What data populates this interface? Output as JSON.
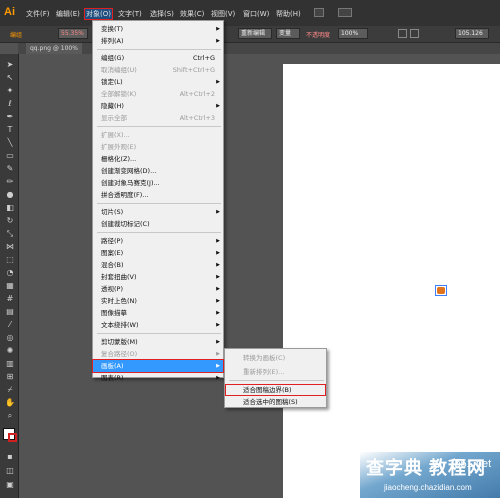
{
  "app": {
    "logo": "Ai"
  },
  "menubar": {
    "items": [
      "文件(F)",
      "编辑(E)",
      "对象(O)",
      "文字(T)",
      "选择(S)",
      "效果(C)",
      "视图(V)",
      "窗口(W)",
      "帮助(H)"
    ]
  },
  "controlbar": {
    "left_label": "编组",
    "opacity_left": "55.35%",
    "stroke_dropdown": "基本",
    "style_label": "重新编辑",
    "preset_label": "变量",
    "opacity_label": "不透明度",
    "opacity_value": "100%",
    "width_value": "105.126"
  },
  "document_tab": {
    "label": "qq.png @ 100%"
  },
  "object_menu": {
    "items": [
      {
        "label": "变换(T)",
        "shortcut": "",
        "submenu": true,
        "disabled": false
      },
      {
        "label": "排列(A)",
        "shortcut": "",
        "submenu": true,
        "disabled": false
      },
      {
        "sep": true
      },
      {
        "label": "编组(G)",
        "shortcut": "Ctrl+G",
        "submenu": false,
        "disabled": false
      },
      {
        "label": "取消编组(U)",
        "shortcut": "Shift+Ctrl+G",
        "submenu": false,
        "disabled": true
      },
      {
        "label": "锁定(L)",
        "shortcut": "",
        "submenu": true,
        "disabled": false
      },
      {
        "label": "全部解锁(K)",
        "shortcut": "Alt+Ctrl+2",
        "submenu": false,
        "disabled": true
      },
      {
        "label": "隐藏(H)",
        "shortcut": "",
        "submenu": true,
        "disabled": false
      },
      {
        "label": "显示全部",
        "shortcut": "Alt+Ctrl+3",
        "submenu": false,
        "disabled": true
      },
      {
        "sep": true
      },
      {
        "label": "扩展(X)...",
        "shortcut": "",
        "submenu": false,
        "disabled": true
      },
      {
        "label": "扩展外观(E)",
        "shortcut": "",
        "submenu": false,
        "disabled": true
      },
      {
        "label": "栅格化(Z)...",
        "shortcut": "",
        "submenu": false,
        "disabled": false
      },
      {
        "label": "创建渐变网格(D)...",
        "shortcut": "",
        "submenu": false,
        "disabled": false
      },
      {
        "label": "创建对象马赛克(J)...",
        "shortcut": "",
        "submenu": false,
        "disabled": false
      },
      {
        "label": "拼合透明度(F)...",
        "shortcut": "",
        "submenu": false,
        "disabled": false
      },
      {
        "sep": true
      },
      {
        "label": "切片(S)",
        "shortcut": "",
        "submenu": true,
        "disabled": false
      },
      {
        "label": "创建裁切标记(C)",
        "shortcut": "",
        "submenu": false,
        "disabled": false
      },
      {
        "sep": true
      },
      {
        "label": "路径(P)",
        "shortcut": "",
        "submenu": true,
        "disabled": false
      },
      {
        "label": "图案(E)",
        "shortcut": "",
        "submenu": true,
        "disabled": false
      },
      {
        "label": "混合(B)",
        "shortcut": "",
        "submenu": true,
        "disabled": false
      },
      {
        "label": "封套扭曲(V)",
        "shortcut": "",
        "submenu": true,
        "disabled": false
      },
      {
        "label": "透视(P)",
        "shortcut": "",
        "submenu": true,
        "disabled": false
      },
      {
        "label": "实时上色(N)",
        "shortcut": "",
        "submenu": true,
        "disabled": false
      },
      {
        "label": "图像描摹",
        "shortcut": "",
        "submenu": true,
        "disabled": false
      },
      {
        "label": "文本绕排(W)",
        "shortcut": "",
        "submenu": true,
        "disabled": false
      },
      {
        "sep": true
      },
      {
        "label": "剪切蒙版(M)",
        "shortcut": "",
        "submenu": true,
        "disabled": false
      },
      {
        "label": "复合路径(O)",
        "shortcut": "",
        "submenu": true,
        "disabled": true
      },
      {
        "label": "画板(A)",
        "shortcut": "",
        "submenu": true,
        "disabled": false,
        "highlighted": true
      },
      {
        "label": "图表(R)",
        "shortcut": "",
        "submenu": true,
        "disabled": false
      }
    ]
  },
  "artboard_submenu": {
    "items": [
      {
        "label": "转换为画板(C)",
        "disabled": true
      },
      {
        "label": "重新排列(E)...",
        "disabled": true
      },
      {
        "label": "适合图稿边界(B)",
        "disabled": false,
        "boxed": true
      },
      {
        "label": "适合选中的图稿(S)",
        "disabled": false
      }
    ]
  },
  "watermark": {
    "main": "查字典 教程网",
    "site": "jb51.net",
    "url": "jiaocheng.chazidian.com"
  },
  "colors": {
    "menu_highlight": "#3399ff",
    "annotation_red": "#e02020",
    "logo_orange": "#ff9a00"
  }
}
